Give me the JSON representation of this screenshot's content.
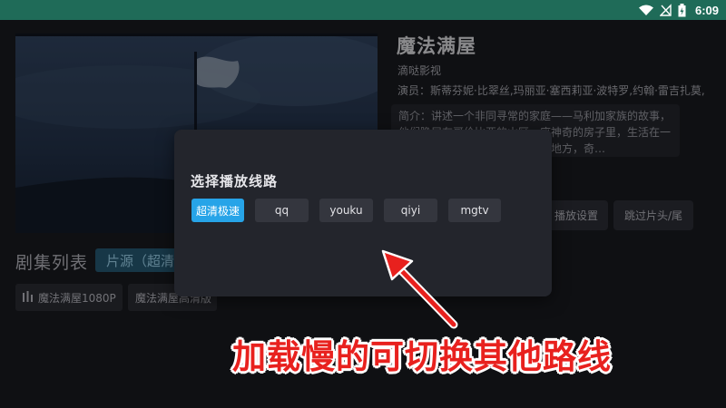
{
  "status_bar": {
    "time": "6:09",
    "icons": [
      "wifi-icon",
      "no-signal-icon",
      "battery-icon"
    ],
    "color": "#1f6b58"
  },
  "detail": {
    "title": "魔法满屋",
    "source": "滴哒影视",
    "cast": "演员：斯蒂芬妮·比翠丝,玛丽亚·塞西莉亚·波特罗,约翰·雷吉扎莫,",
    "synopsis_line1": "简介：讲述一个非同寻常的家庭——马利加家族的故事，",
    "synopsis_line2": "他们隐居在哥伦比亚的山区一座神奇的房子里，生活在一",
    "synopsis_line3": "个充满惊奇的地方、充满魅力的地方，奇…",
    "settings_label": "播放设置",
    "skip_label": "跳过片头/尾"
  },
  "episodes": {
    "heading": "剧集列表",
    "source_tag": "片源（超清",
    "items": [
      {
        "label": "魔法满屋1080P",
        "icon": "playing-bars-icon"
      },
      {
        "label": "魔法满屋高清版"
      }
    ]
  },
  "dialog": {
    "title": "选择播放线路",
    "routes": [
      "超清极速",
      "qq",
      "youku",
      "qiyi",
      "mgtv"
    ],
    "selected_index": 0
  },
  "annotation": {
    "caption": "加载慢的可切换其他路线",
    "color": "#e8211e"
  },
  "colors": {
    "accent": "#27a4e8",
    "background": "#131417"
  }
}
